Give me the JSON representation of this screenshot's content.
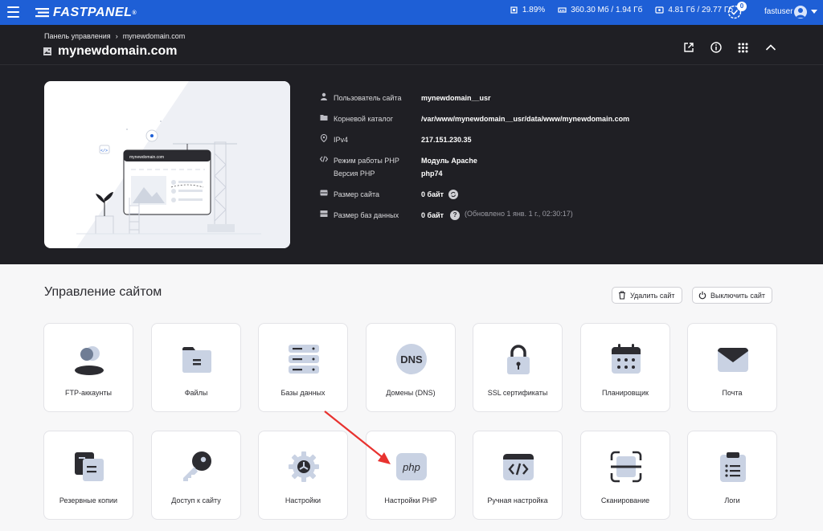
{
  "topbar": {
    "logo_text": "FASTPANEL",
    "registered_mark": "®",
    "cpu": "1.89%",
    "ram": "360.30 Мб / 1.94 Гб",
    "disk": "4.81 Гб / 29.77 Гб",
    "notifications_count": "0",
    "username": "fastuser",
    "brand_color": "#1e5fd6"
  },
  "breadcrumb": {
    "root": "Панель управления",
    "separator": "›",
    "current": "mynewdomain.com"
  },
  "site": {
    "title": "mynewdomain.com",
    "preview_domain": "mynewdomain.com"
  },
  "info": {
    "user_label": "Пользователь сайта",
    "user_value": "mynewdomain__usr",
    "root_label": "Корневой каталог",
    "root_value": "/var/www/mynewdomain__usr/data/www/mynewdomain.com",
    "ip_label": "IPv4",
    "ip_value": "217.151.230.35",
    "php_mode_label": "Режим работы PHP",
    "php_mode_value": "Модуль Apache",
    "php_version_label": "Версия PHP",
    "php_version_value": "php74",
    "site_size_label": "Размер сайта",
    "site_size_value": "0 байт",
    "db_size_label": "Размер баз данных",
    "db_size_value": "0 байт",
    "db_help": "?",
    "db_updated": "(Обновлено 1 янв. 1 г., 02:30:17)"
  },
  "management": {
    "title": "Управление сайтом",
    "delete_label": "Удалить сайт",
    "disable_label": "Выключить сайт",
    "cards": [
      {
        "label": "FTP-аккаунты",
        "icon": "users-icon"
      },
      {
        "label": "Файлы",
        "icon": "folder-icon"
      },
      {
        "label": "Базы данных",
        "icon": "database-icon"
      },
      {
        "label": "Домены (DNS)",
        "icon": "dns-icon",
        "icon_text": "DNS"
      },
      {
        "label": "SSL сертификаты",
        "icon": "lock-icon"
      },
      {
        "label": "Планировщик",
        "icon": "calendar-icon"
      },
      {
        "label": "Почта",
        "icon": "mail-icon"
      },
      {
        "label": "Резервные копии",
        "icon": "backup-icon"
      },
      {
        "label": "Доступ к сайту",
        "icon": "key-icon"
      },
      {
        "label": "Настройки",
        "icon": "gear-icon"
      },
      {
        "label": "Настройки PHP",
        "icon": "php-icon",
        "icon_text": "php"
      },
      {
        "label": "Ручная настройка",
        "icon": "code-icon"
      },
      {
        "label": "Сканирование",
        "icon": "scan-icon"
      },
      {
        "label": "Логи",
        "icon": "clipboard-icon"
      }
    ]
  },
  "colors": {
    "dark_bg": "#1f1f24",
    "icon_fill": "#c9d2e3",
    "icon_dark": "#3a3a40",
    "annotation_arrow": "#e8322f"
  }
}
